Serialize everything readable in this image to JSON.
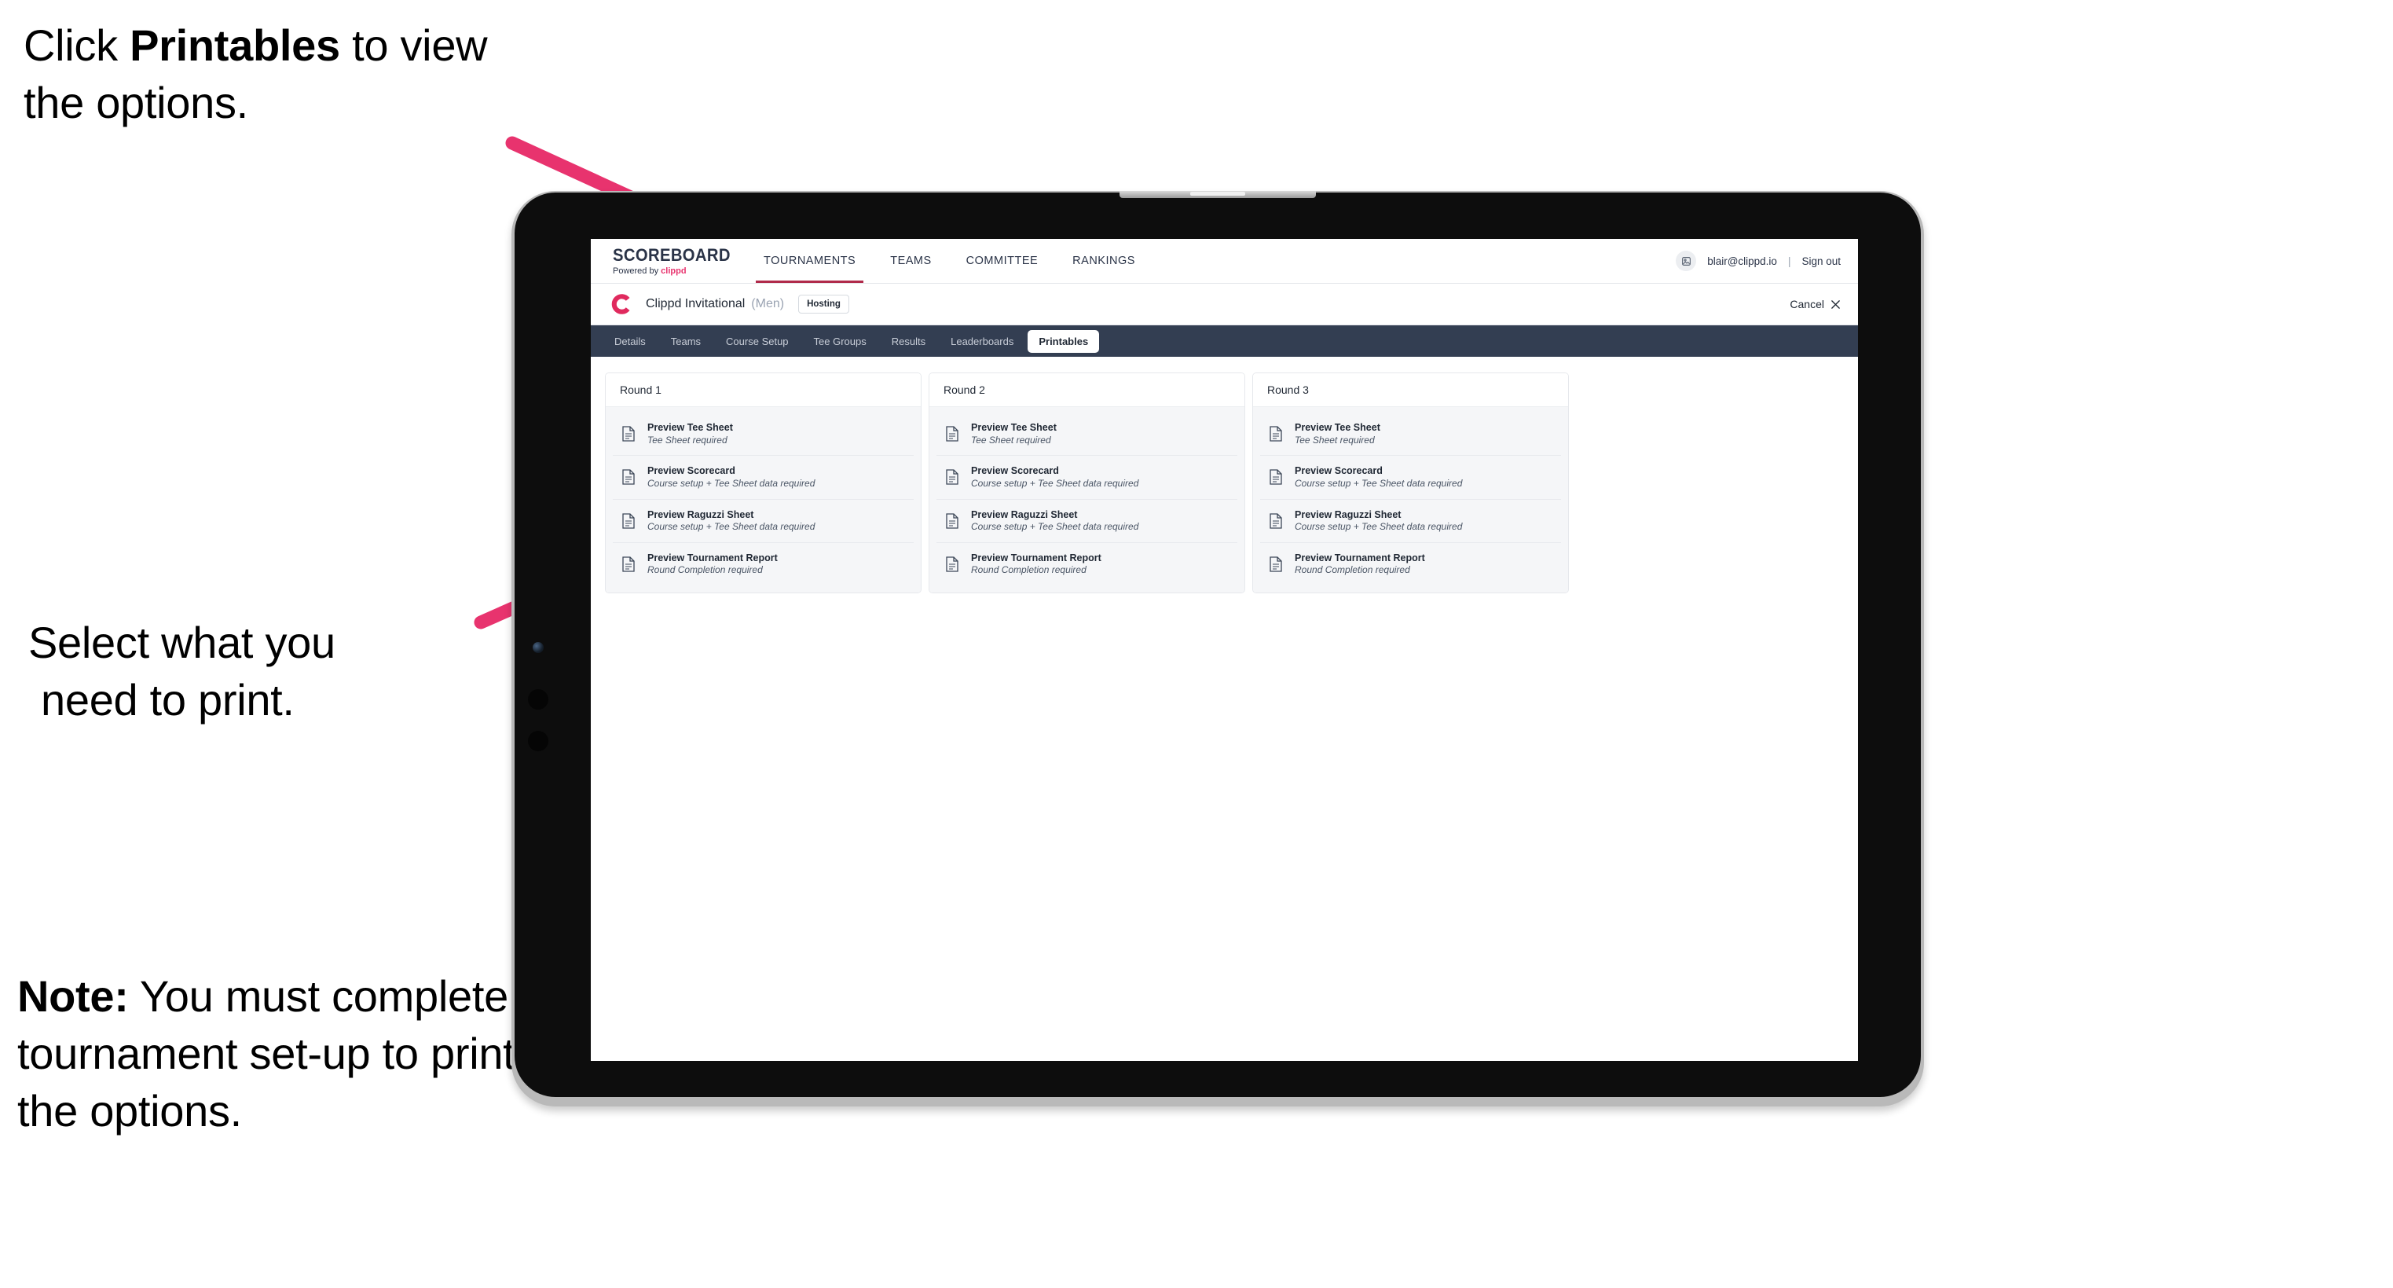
{
  "annotations": {
    "top": {
      "pre": "Click ",
      "bold": "Printables",
      "post": " to view the options."
    },
    "middle": {
      "line1": "Select what you",
      "line2": "need to print."
    },
    "note": {
      "bold": "Note:",
      "text": " You must complete the tournament set-up to print all the options."
    }
  },
  "colors": {
    "arrow_pink": "#e8336e",
    "tabstrip_navy": "#333e52",
    "brand_navy": "#2a3347",
    "accent_underline": "#b02a4a",
    "panel_grey": "#f5f6f8"
  },
  "browser": {
    "topbar": {
      "brand": {
        "title": "SCOREBOARD",
        "powered_prefix": "Powered by ",
        "powered_brand": "clippd"
      },
      "nav": [
        {
          "label": "TOURNAMENTS",
          "active": true
        },
        {
          "label": "TEAMS",
          "active": false
        },
        {
          "label": "COMMITTEE",
          "active": false
        },
        {
          "label": "RANKINGS",
          "active": false
        }
      ],
      "user": {
        "avatar_icon": "user-avatar-icon",
        "email": "blair@clippd.io",
        "separator": "|",
        "signout": "Sign out"
      }
    },
    "tournament_bar": {
      "logo_icon": "clippd-c-logo-icon",
      "name": "Clippd Invitational",
      "gender": "(Men)",
      "status_badge": "Hosting",
      "cancel_label": "Cancel",
      "cancel_icon": "close-x-icon"
    },
    "tabs": [
      {
        "label": "Details",
        "active": false
      },
      {
        "label": "Teams",
        "active": false
      },
      {
        "label": "Course Setup",
        "active": false
      },
      {
        "label": "Tee Groups",
        "active": false
      },
      {
        "label": "Results",
        "active": false
      },
      {
        "label": "Leaderboards",
        "active": false
      },
      {
        "label": "Printables",
        "active": true
      }
    ],
    "rounds": [
      {
        "title": "Round 1",
        "items": [
          {
            "title": "Preview Tee Sheet",
            "subtitle": "Tee Sheet required",
            "icon": "document-icon"
          },
          {
            "title": "Preview Scorecard",
            "subtitle": "Course setup + Tee Sheet data required",
            "icon": "document-icon"
          },
          {
            "title": "Preview Raguzzi Sheet",
            "subtitle": "Course setup + Tee Sheet data required",
            "icon": "document-icon"
          },
          {
            "title": "Preview Tournament Report",
            "subtitle": "Round Completion required",
            "icon": "document-icon"
          }
        ]
      },
      {
        "title": "Round 2",
        "items": [
          {
            "title": "Preview Tee Sheet",
            "subtitle": "Tee Sheet required",
            "icon": "document-icon"
          },
          {
            "title": "Preview Scorecard",
            "subtitle": "Course setup + Tee Sheet data required",
            "icon": "document-icon"
          },
          {
            "title": "Preview Raguzzi Sheet",
            "subtitle": "Course setup + Tee Sheet data required",
            "icon": "document-icon"
          },
          {
            "title": "Preview Tournament Report",
            "subtitle": "Round Completion required",
            "icon": "document-icon"
          }
        ]
      },
      {
        "title": "Round 3",
        "items": [
          {
            "title": "Preview Tee Sheet",
            "subtitle": "Tee Sheet required",
            "icon": "document-icon"
          },
          {
            "title": "Preview Scorecard",
            "subtitle": "Course setup + Tee Sheet data required",
            "icon": "document-icon"
          },
          {
            "title": "Preview Raguzzi Sheet",
            "subtitle": "Course setup + Tee Sheet data required",
            "icon": "document-icon"
          },
          {
            "title": "Preview Tournament Report",
            "subtitle": "Round Completion required",
            "icon": "document-icon"
          }
        ]
      }
    ]
  }
}
